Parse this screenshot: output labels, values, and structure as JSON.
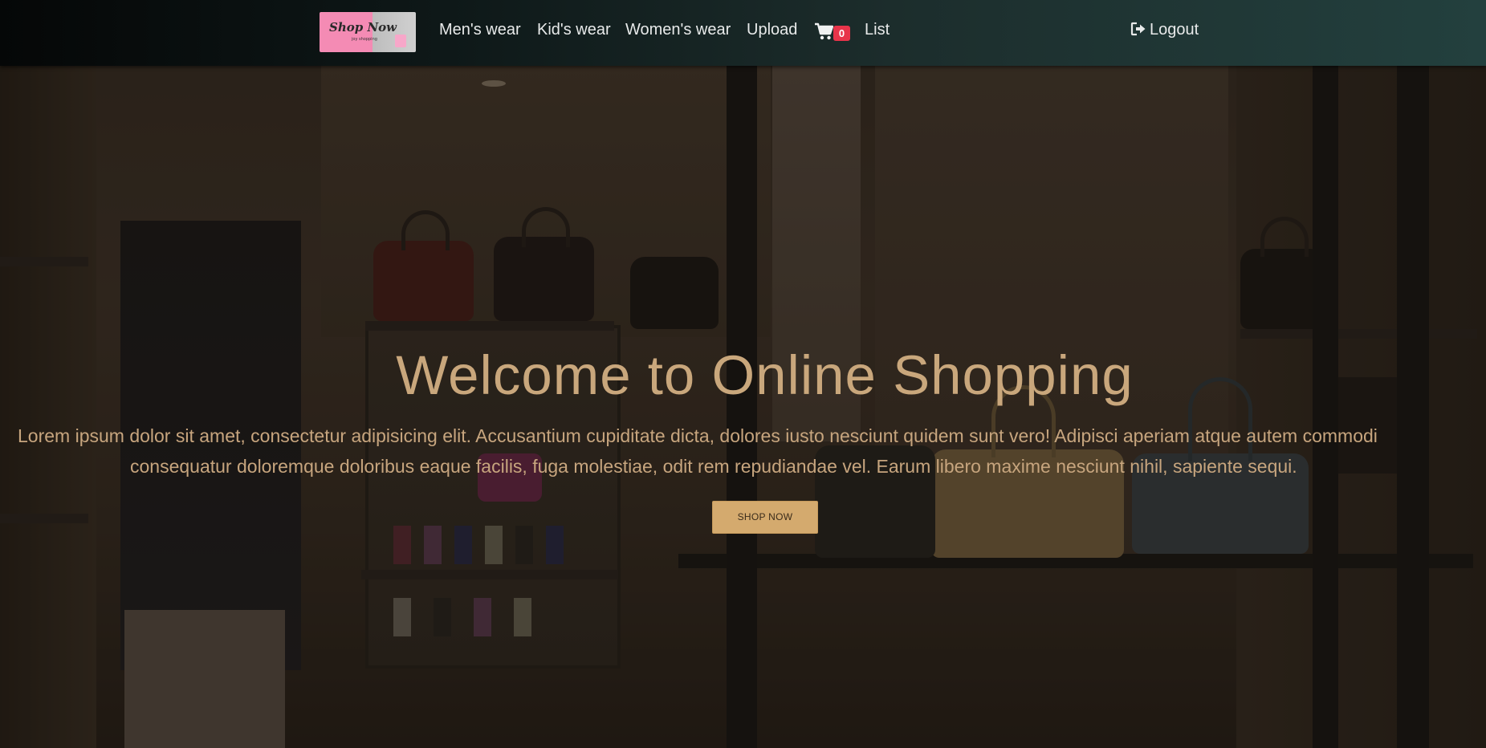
{
  "navbar": {
    "logo": {
      "text": "Shop Now",
      "tagline": "joy shopping",
      "colors": {
        "pink": "#f48bb4",
        "gray": "#c8c8c8"
      }
    },
    "items": [
      {
        "label": "Men's wear"
      },
      {
        "label": "Kid's wear"
      },
      {
        "label": "Women's wear"
      },
      {
        "label": "Upload"
      },
      {
        "label": "List"
      }
    ],
    "cart": {
      "icon": "shopping-cart-icon",
      "count": "0",
      "badge_color": "#e8344a"
    },
    "logout": {
      "label": "Logout",
      "icon": "sign-out-icon"
    }
  },
  "hero": {
    "title": "Welcome to Online Shopping",
    "description_line1": "Lorem ipsum dolor sit amet, consectetur adipisicing elit. Accusantium cupiditate dicta, dolores iusto nesciunt quidem sunt vero! Adipisci aperiam atque autem commodi",
    "description_line2": "consequatur doloremque doloribus eaque facilis, fuga molestiae, odit rem repudiandae vel. Earum libero maxime nesciunt nihil, sapiente sequi.",
    "button_label": "SHOP NOW",
    "accent_color": "#d4aa6e",
    "text_color": "#c9a77c"
  }
}
